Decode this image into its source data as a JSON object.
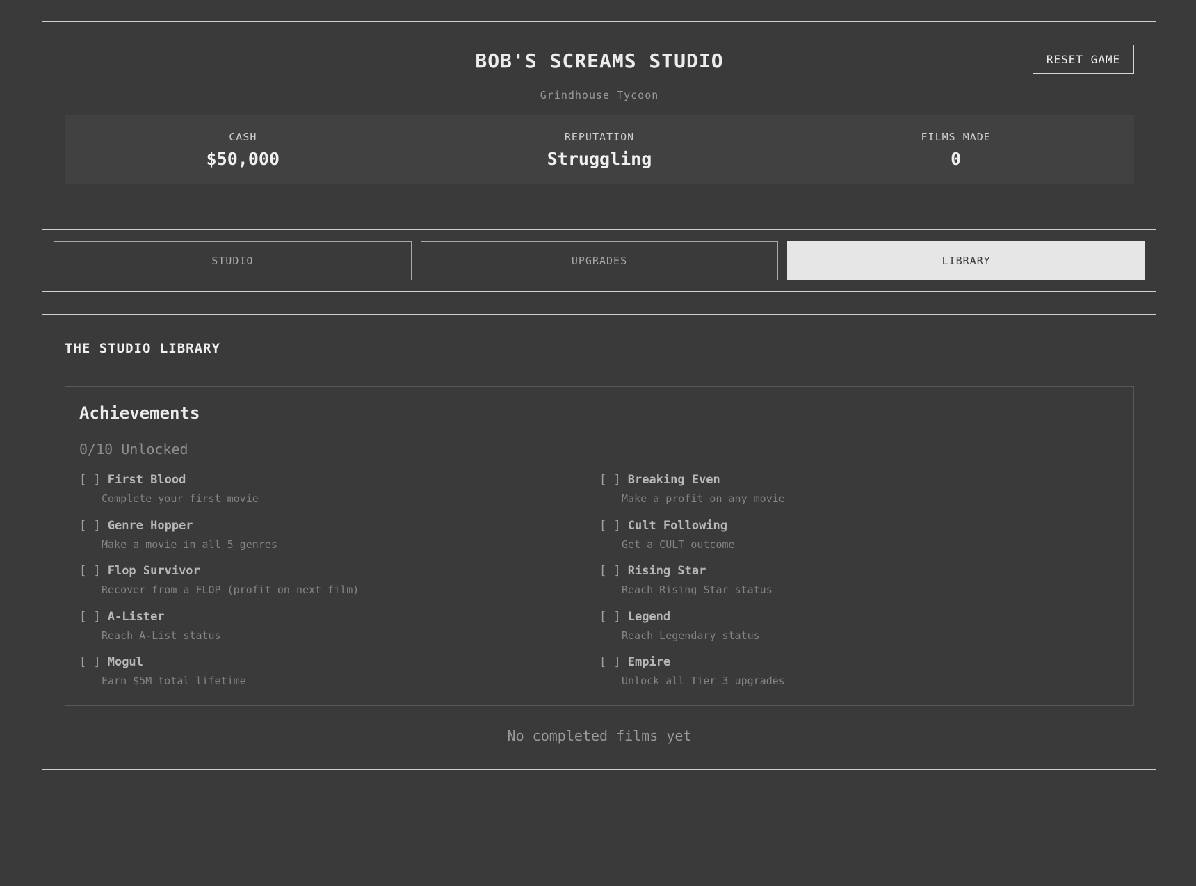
{
  "header": {
    "title": "BOB'S SCREAMS STUDIO",
    "subtitle": "Grindhouse Tycoon",
    "reset_label": "RESET GAME"
  },
  "stats": [
    {
      "label": "CASH",
      "value": "$50,000"
    },
    {
      "label": "REPUTATION",
      "value": "Struggling"
    },
    {
      "label": "FILMS MADE",
      "value": "0"
    }
  ],
  "tabs": [
    {
      "label": "STUDIO",
      "active": false
    },
    {
      "label": "UPGRADES",
      "active": false
    },
    {
      "label": "LIBRARY",
      "active": true
    }
  ],
  "library": {
    "title": "THE STUDIO LIBRARY",
    "achievements_title": "Achievements",
    "unlocked_text": "0/10 Unlocked",
    "achievements": [
      {
        "check": "[ ]",
        "name": "First Blood",
        "desc": "Complete your first movie"
      },
      {
        "check": "[ ]",
        "name": "Breaking Even",
        "desc": "Make a profit on any movie"
      },
      {
        "check": "[ ]",
        "name": "Genre Hopper",
        "desc": "Make a movie in all 5 genres"
      },
      {
        "check": "[ ]",
        "name": "Cult Following",
        "desc": "Get a CULT outcome"
      },
      {
        "check": "[ ]",
        "name": "Flop Survivor",
        "desc": "Recover from a FLOP (profit on next film)"
      },
      {
        "check": "[ ]",
        "name": "Rising Star",
        "desc": "Reach Rising Star status"
      },
      {
        "check": "[ ]",
        "name": "A-Lister",
        "desc": "Reach A-List status"
      },
      {
        "check": "[ ]",
        "name": "Legend",
        "desc": "Reach Legendary status"
      },
      {
        "check": "[ ]",
        "name": "Mogul",
        "desc": "Earn $5M total lifetime"
      },
      {
        "check": "[ ]",
        "name": "Empire",
        "desc": "Unlock all Tier 3 upgrades"
      }
    ],
    "empty_message": "No completed films yet"
  }
}
